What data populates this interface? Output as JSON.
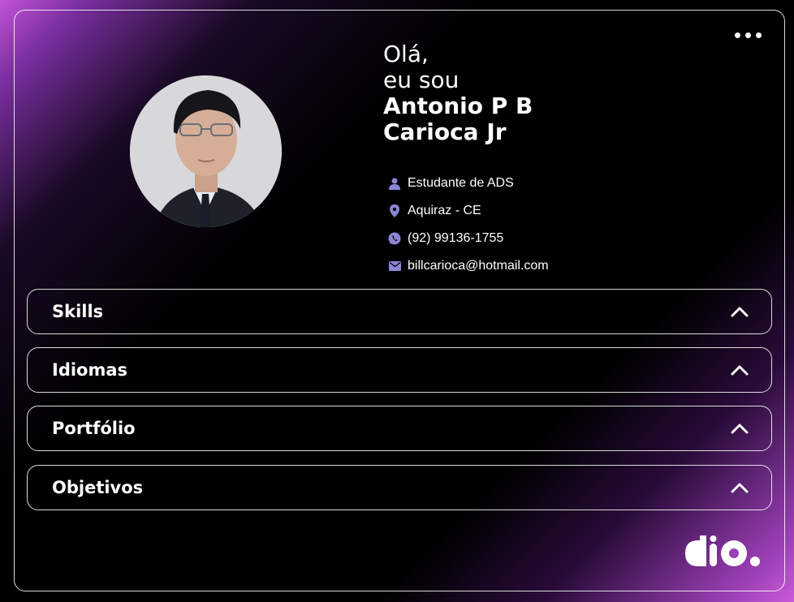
{
  "greeting": {
    "line1": "Olá,",
    "line2": "eu sou",
    "name_line1": "Antonio P B",
    "name_line2": "Carioca Jr"
  },
  "info": [
    {
      "icon": "user-icon",
      "text": "Estudante de ADS"
    },
    {
      "icon": "location-pin-icon",
      "text": "Aquiraz - CE"
    },
    {
      "icon": "whatsapp-icon",
      "text": "(92) 99136-1755"
    },
    {
      "icon": "email-icon",
      "text": "billcarioca@hotmail.com"
    }
  ],
  "sections": [
    {
      "label": "Skills"
    },
    {
      "label": "Idiomas"
    },
    {
      "label": "Portfólio"
    },
    {
      "label": "Objetivos"
    }
  ],
  "colors": {
    "accent": "#c454d8",
    "icon": "#8a86d6",
    "border": "#ffffff"
  }
}
